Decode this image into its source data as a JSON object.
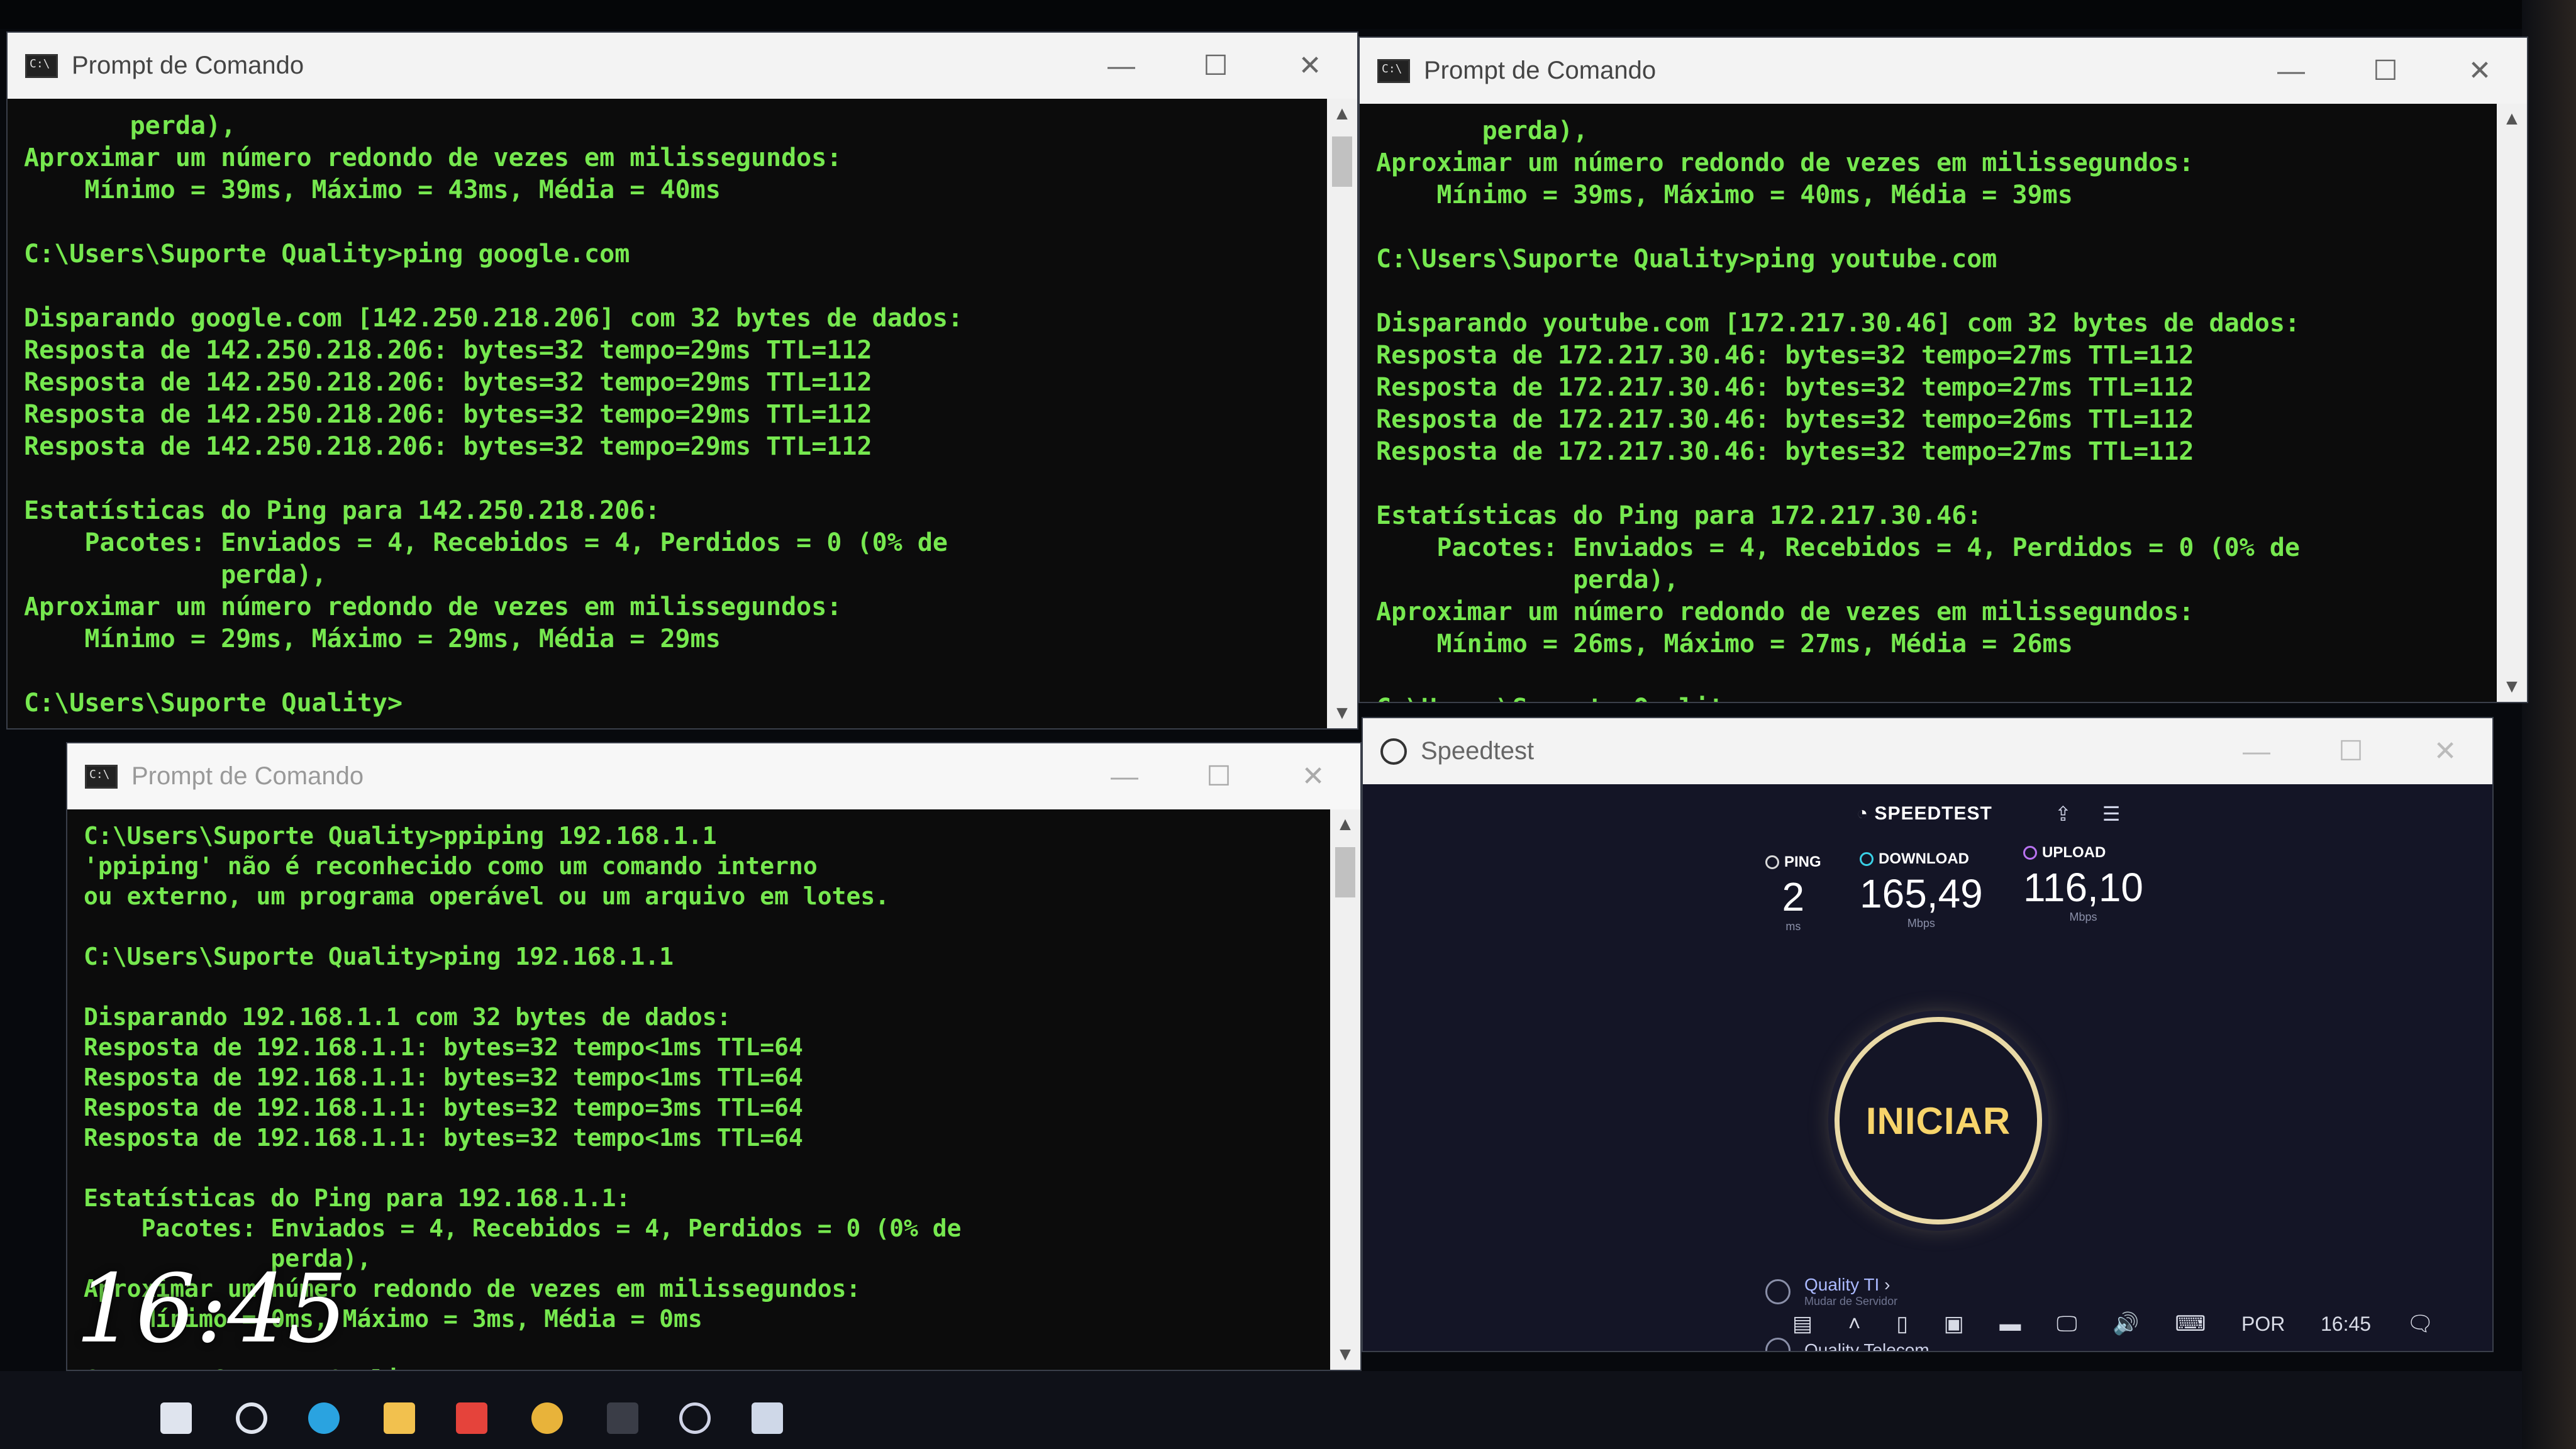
{
  "windows": {
    "cmd_top_left": {
      "title": "Prompt de Comando",
      "lines": [
        "       perda),",
        "Aproximar um número redondo de vezes em milissegundos:",
        "    Mínimo = 39ms, Máximo = 43ms, Média = 40ms",
        "",
        "C:\\Users\\Suporte Quality>ping google.com",
        "",
        "Disparando google.com [142.250.218.206] com 32 bytes de dados:",
        "Resposta de 142.250.218.206: bytes=32 tempo=29ms TTL=112",
        "Resposta de 142.250.218.206: bytes=32 tempo=29ms TTL=112",
        "Resposta de 142.250.218.206: bytes=32 tempo=29ms TTL=112",
        "Resposta de 142.250.218.206: bytes=32 tempo=29ms TTL=112",
        "",
        "Estatísticas do Ping para 142.250.218.206:",
        "    Pacotes: Enviados = 4, Recebidos = 4, Perdidos = 0 (0% de",
        "             perda),",
        "Aproximar um número redondo de vezes em milissegundos:",
        "    Mínimo = 29ms, Máximo = 29ms, Média = 29ms",
        "",
        "C:\\Users\\Suporte Quality>"
      ]
    },
    "cmd_top_right": {
      "title": "Prompt de Comando",
      "lines": [
        "       perda),",
        "Aproximar um número redondo de vezes em milissegundos:",
        "    Mínimo = 39ms, Máximo = 40ms, Média = 39ms",
        "",
        "C:\\Users\\Suporte Quality>ping youtube.com",
        "",
        "Disparando youtube.com [172.217.30.46] com 32 bytes de dados:",
        "Resposta de 172.217.30.46: bytes=32 tempo=27ms TTL=112",
        "Resposta de 172.217.30.46: bytes=32 tempo=27ms TTL=112",
        "Resposta de 172.217.30.46: bytes=32 tempo=26ms TTL=112",
        "Resposta de 172.217.30.46: bytes=32 tempo=27ms TTL=112",
        "",
        "Estatísticas do Ping para 172.217.30.46:",
        "    Pacotes: Enviados = 4, Recebidos = 4, Perdidos = 0 (0% de",
        "             perda),",
        "Aproximar um número redondo de vezes em milissegundos:",
        "    Mínimo = 26ms, Máximo = 27ms, Média = 26ms",
        "",
        "C:\\Users\\Suporte Quality>"
      ]
    },
    "cmd_bottom_left": {
      "title": "Prompt de Comando",
      "lines": [
        "C:\\Users\\Suporte Quality>ppiping 192.168.1.1",
        "'ppiping' não é reconhecido como um comando interno",
        "ou externo, um programa operável ou um arquivo em lotes.",
        "",
        "C:\\Users\\Suporte Quality>ping 192.168.1.1",
        "",
        "Disparando 192.168.1.1 com 32 bytes de dados:",
        "Resposta de 192.168.1.1: bytes=32 tempo<1ms TTL=64",
        "Resposta de 192.168.1.1: bytes=32 tempo<1ms TTL=64",
        "Resposta de 192.168.1.1: bytes=32 tempo=3ms TTL=64",
        "Resposta de 192.168.1.1: bytes=32 tempo<1ms TTL=64",
        "",
        "Estatísticas do Ping para 192.168.1.1:",
        "    Pacotes: Enviados = 4, Recebidos = 4, Perdidos = 0 (0% de",
        "             perda),",
        "Aproximar um número redondo de vezes em milissegundos:",
        "    Mínimo = 0ms, Máximo = 3ms, Média = 0ms",
        "",
        "C:\\Users\\Suporte Quality>"
      ]
    },
    "speedtest": {
      "title": "Speedtest",
      "logo": "SPEEDTEST",
      "ping_label": "PING",
      "ping_value": "2",
      "ping_unit": "ms",
      "download_label": "DOWNLOAD",
      "download_value": "165,49",
      "download_unit": "Mbps",
      "upload_label": "UPLOAD",
      "upload_value": "116,10",
      "upload_unit": "Mbps",
      "start_button": "INICIAR",
      "isp_name": "Quality TI",
      "isp_sub": "Mudar de Servidor",
      "server_name": "Quality Telecom"
    }
  },
  "taskbar": {
    "language": "POR",
    "time": "16:45"
  },
  "overlay_clock": "16:45",
  "colors": {
    "terminal_text": "#76e84f",
    "terminal_bg": "#0c0c0c",
    "speedtest_bg": "#141526",
    "speedtest_accent": "#f7d46a"
  }
}
